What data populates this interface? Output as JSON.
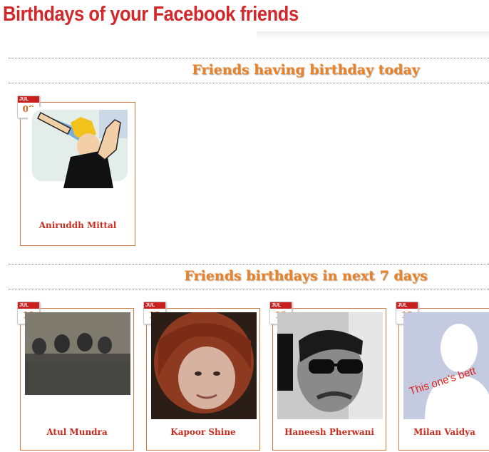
{
  "page": {
    "title": "Birthdays of your Facebook friends"
  },
  "sections": {
    "today": {
      "title": "Friends having birthday today",
      "friends": [
        {
          "name": "Aniruddh Mittal",
          "month": "JUL",
          "day": "09"
        }
      ]
    },
    "next7": {
      "title": "Friends birthdays in next 7 days",
      "friends": [
        {
          "name": "Atul Mundra",
          "month": "JUL",
          "day": "10"
        },
        {
          "name": "Kapoor Shine",
          "month": "JUL",
          "day": "12"
        },
        {
          "name": "Haneesh Pherwani",
          "month": "JUL",
          "day": "13"
        },
        {
          "name": "Milan Vaidya",
          "month": "JUL",
          "day": "13",
          "photo_text": "This one's bett"
        }
      ]
    }
  },
  "colors": {
    "title": "#d2272b",
    "section_title": "#e8832a",
    "card_border": "#cd7a45",
    "calendar_header": "#c8201f",
    "name": "#cc2d1d"
  }
}
